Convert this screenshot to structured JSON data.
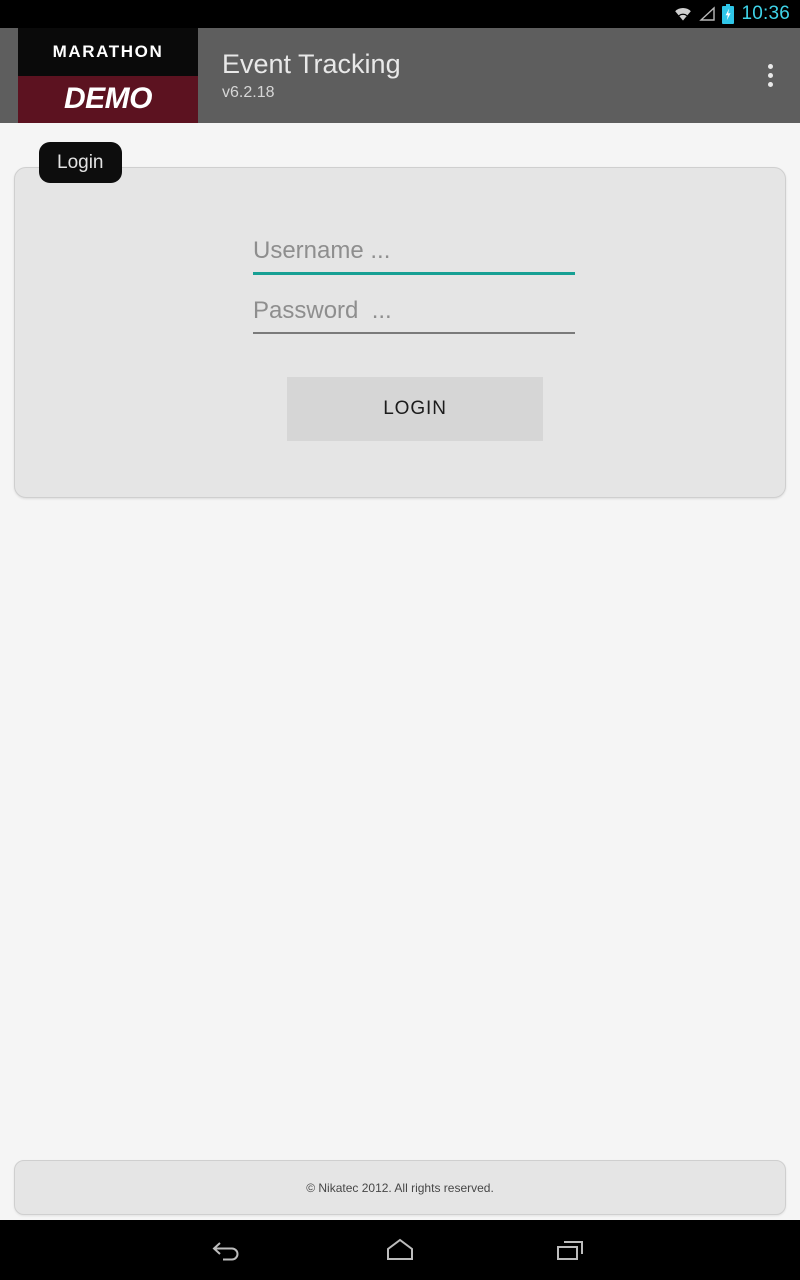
{
  "status_bar": {
    "clock": "10:36",
    "clock_color": "#3fd3e8",
    "icons": [
      "wifi-icon",
      "signal-icon",
      "battery-charging-icon"
    ]
  },
  "app_bar": {
    "background_color": "#5e5e5e",
    "logo": {
      "top_text": "MARATHON",
      "bottom_text": "DEMO",
      "top_background": "#0a0a0a",
      "bottom_background": "#5c1220"
    },
    "title": "Event Tracking",
    "version": "v6.2.18",
    "overflow_label": "More options"
  },
  "login": {
    "tab_label": "Login",
    "card_background": "#e5e5e5",
    "accent_color": "#17a094",
    "username": {
      "placeholder": "Username ...",
      "value": "",
      "focused": true
    },
    "password": {
      "placeholder": "Password  ...",
      "value": "",
      "focused": false
    },
    "submit_label": "LOGIN"
  },
  "footer": {
    "copyright": "© Nikatec 2012. All rights reserved."
  },
  "nav_bar": {
    "buttons": [
      "back-icon",
      "home-icon",
      "recents-icon"
    ]
  }
}
